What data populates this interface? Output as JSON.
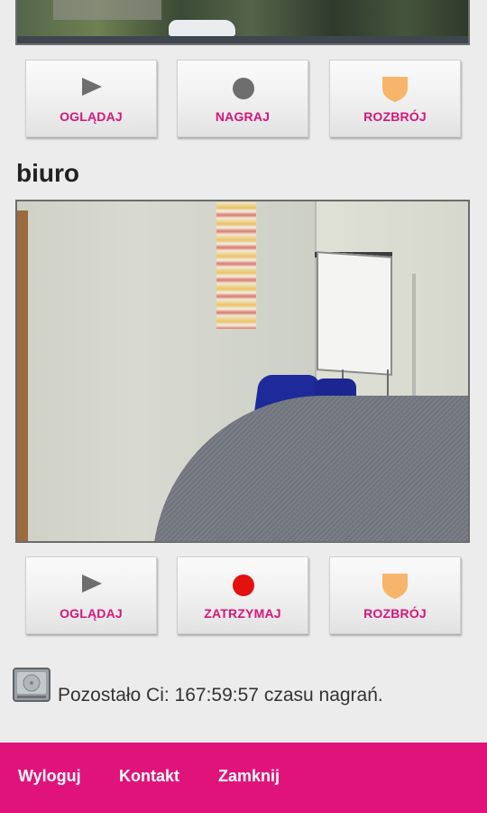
{
  "cameras": [
    {
      "name": "",
      "buttons": {
        "watch": {
          "label": "OGLĄDAJ",
          "icon": "play-icon"
        },
        "record": {
          "label": "NAGRAJ",
          "icon": "record-dot-gray-icon",
          "color": "#6e6e6e"
        },
        "disarm": {
          "label": "ROZBRÓJ",
          "icon": "shield-icon",
          "color": "#f6b56a"
        }
      }
    },
    {
      "name": "biuro",
      "buttons": {
        "watch": {
          "label": "OGLĄDAJ",
          "icon": "play-icon"
        },
        "stop": {
          "label": "ZATRZYMAJ",
          "icon": "record-dot-red-icon",
          "color": "#e51010"
        },
        "disarm": {
          "label": "ROZBRÓJ",
          "icon": "shield-icon",
          "color": "#f6b56a"
        }
      }
    }
  ],
  "recording": {
    "text": "Pozostało Ci: 167:59:57 czasu nagrań."
  },
  "footer": {
    "links": [
      "Wyloguj",
      "Kontakt",
      "Zamknij"
    ]
  },
  "colors": {
    "accent": "#e0137a",
    "button_text": "#d8157a"
  }
}
